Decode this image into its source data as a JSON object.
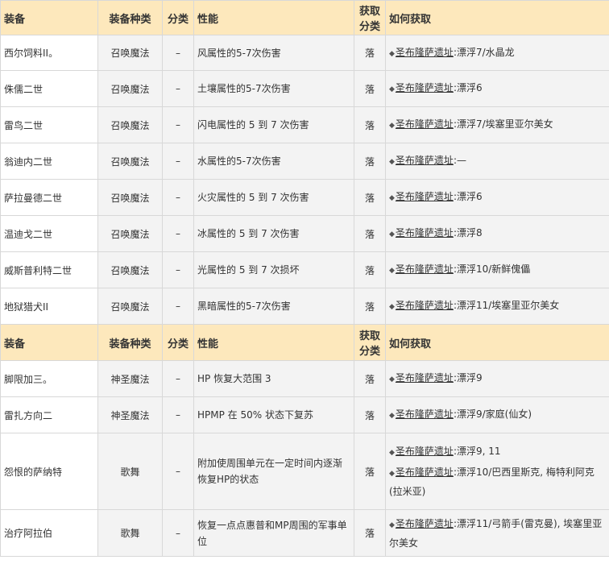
{
  "headers": {
    "equipment": "装备",
    "equip_type": "装备种类",
    "category": "分类",
    "performance": "性能",
    "obtain_category": "获取\n分类",
    "how_obtain": "如何获取"
  },
  "rows_group1": [
    {
      "name": "西尔饲料II。",
      "type": "召唤魔法",
      "cat": "–",
      "perf": "风属性的5-7次伤害",
      "ocat": "落",
      "obtain": [
        {
          "place": "圣布隆萨遗址",
          "detail": ":漂浮7/水晶龙"
        }
      ]
    },
    {
      "name": "侏儒二世",
      "type": "召唤魔法",
      "cat": "–",
      "perf": "土壤属性的5-7次伤害",
      "ocat": "落",
      "obtain": [
        {
          "place": "圣布隆萨遗址",
          "detail": ":漂浮6"
        }
      ]
    },
    {
      "name": "雷鸟二世",
      "type": "召唤魔法",
      "cat": "–",
      "perf": "闪电属性的 5 到 7 次伤害",
      "ocat": "落",
      "obtain": [
        {
          "place": "圣布隆萨遗址",
          "detail": ":漂浮7/埃塞里亚尔美女"
        }
      ]
    },
    {
      "name": "翁迪内二世",
      "type": "召唤魔法",
      "cat": "–",
      "perf": "水属性的5-7次伤害",
      "ocat": "落",
      "obtain": [
        {
          "place": "圣布隆萨遗址",
          "detail": ":—"
        }
      ]
    },
    {
      "name": "萨拉曼德二世",
      "type": "召唤魔法",
      "cat": "–",
      "perf": "火灾属性的 5 到 7 次伤害",
      "ocat": "落",
      "obtain": [
        {
          "place": "圣布隆萨遗址",
          "detail": ":漂浮6"
        }
      ]
    },
    {
      "name": "温迪戈二世",
      "type": "召唤魔法",
      "cat": "–",
      "perf": "冰属性的 5 到 7 次伤害",
      "ocat": "落",
      "obtain": [
        {
          "place": "圣布隆萨遗址",
          "detail": ":漂浮8"
        }
      ]
    },
    {
      "name": "威斯普利特二世",
      "type": "召唤魔法",
      "cat": "–",
      "perf": "光属性的 5 到 7 次损坏",
      "ocat": "落",
      "obtain": [
        {
          "place": "圣布隆萨遗址",
          "detail": ":漂浮10/新鲜傀儡"
        }
      ]
    },
    {
      "name": "地狱猎犬II",
      "type": "召唤魔法",
      "cat": "–",
      "perf": "黑暗属性的5-7次伤害",
      "ocat": "落",
      "obtain": [
        {
          "place": "圣布隆萨遗址",
          "detail": ":漂浮11/埃塞里亚尔美女"
        }
      ]
    }
  ],
  "rows_group2": [
    {
      "name": "脚限加三。",
      "type": "神圣魔法",
      "cat": "–",
      "perf": "HP 恢复大范围 3",
      "ocat": "落",
      "obtain": [
        {
          "place": "圣布隆萨遗址",
          "detail": ":漂浮9"
        }
      ]
    },
    {
      "name": "雷扎方向二",
      "type": "神圣魔法",
      "cat": "–",
      "perf": "HPMP 在 50% 状态下复苏",
      "ocat": "落",
      "obtain": [
        {
          "place": "圣布隆萨遗址",
          "detail": ":漂浮9/家庭(仙女)"
        }
      ]
    },
    {
      "name": "怨恨的萨纳特",
      "type": "歌舞",
      "cat": "–",
      "perf": "附加使周围单元在一定时间内逐渐恢复HP的状态",
      "ocat": "落",
      "obtain": [
        {
          "place": "圣布隆萨遗址",
          "detail": ":漂浮9, 11"
        },
        {
          "place": "圣布隆萨遗址",
          "detail": ":漂浮10/巴西里斯克, 梅特利阿克(拉米亚)"
        }
      ]
    },
    {
      "name": "治疗阿拉伯",
      "type": "歌舞",
      "cat": "–",
      "perf": "恢复一点点惠普和MP周围的军事单位",
      "ocat": "落",
      "obtain": [
        {
          "place": "圣布隆萨遗址",
          "detail": ":漂浮11/弓箭手(雷克曼), 埃塞里亚尔美女"
        }
      ]
    }
  ]
}
